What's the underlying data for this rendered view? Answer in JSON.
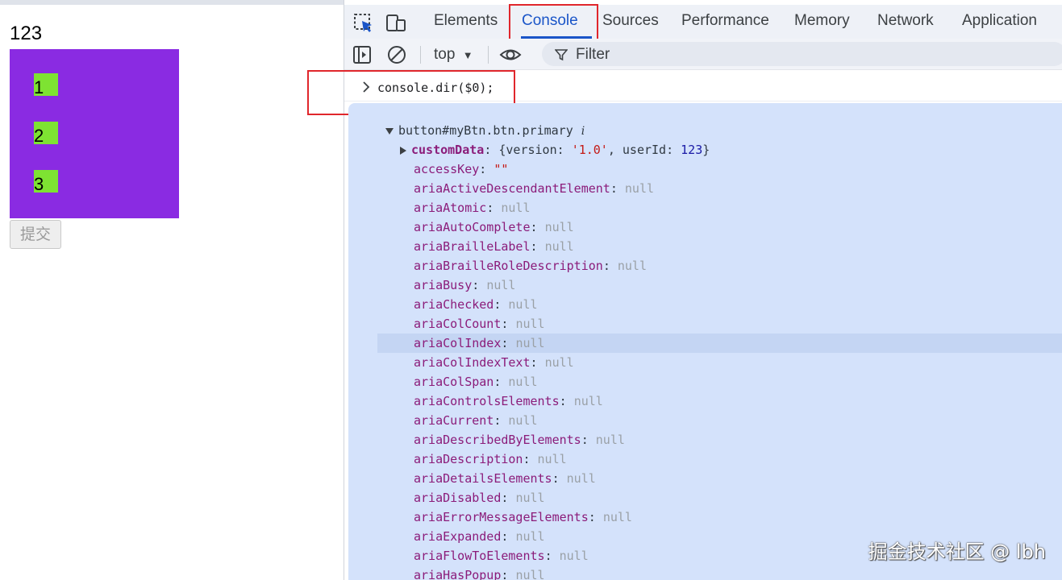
{
  "page": {
    "text": "123",
    "items": [
      "1",
      "2",
      "3"
    ],
    "submit_label": "提交",
    "box_color": "#8a2be2",
    "item_color": "#7ee332"
  },
  "devtools": {
    "tabs": [
      "Elements",
      "Console",
      "Sources",
      "Performance",
      "Memory",
      "Network",
      "Application"
    ],
    "active_tab": "Console",
    "context": "top",
    "filter_placeholder": "Filter",
    "command": "console.dir($0);",
    "object_label": "button#myBtn.btn.primary",
    "info_icon": "i",
    "custom_data": {
      "key": "customData",
      "open": "{version: ",
      "version": "'1.0'",
      "mid": ", userId: ",
      "user_id": "123",
      "close": "}"
    },
    "access_key": {
      "key": "accessKey",
      "value": "\"\""
    },
    "null_label": "null",
    "null_properties": [
      "ariaActiveDescendantElement",
      "ariaAtomic",
      "ariaAutoComplete",
      "ariaBrailleLabel",
      "ariaBrailleRoleDescription",
      "ariaBusy",
      "ariaChecked",
      "ariaColCount",
      "ariaColIndex",
      "ariaColIndexText",
      "ariaColSpan",
      "ariaControlsElements",
      "ariaCurrent",
      "ariaDescribedByElements",
      "ariaDescription",
      "ariaDetailsElements",
      "ariaDisabled",
      "ariaErrorMessageElements",
      "ariaExpanded",
      "ariaFlowToElements",
      "ariaHasPopup"
    ],
    "hovered_property": "ariaColIndex",
    "accent_color": "#1a55c8",
    "highlight_color": "#e0262c"
  },
  "watermark": "掘金技术社区 @ lbh"
}
